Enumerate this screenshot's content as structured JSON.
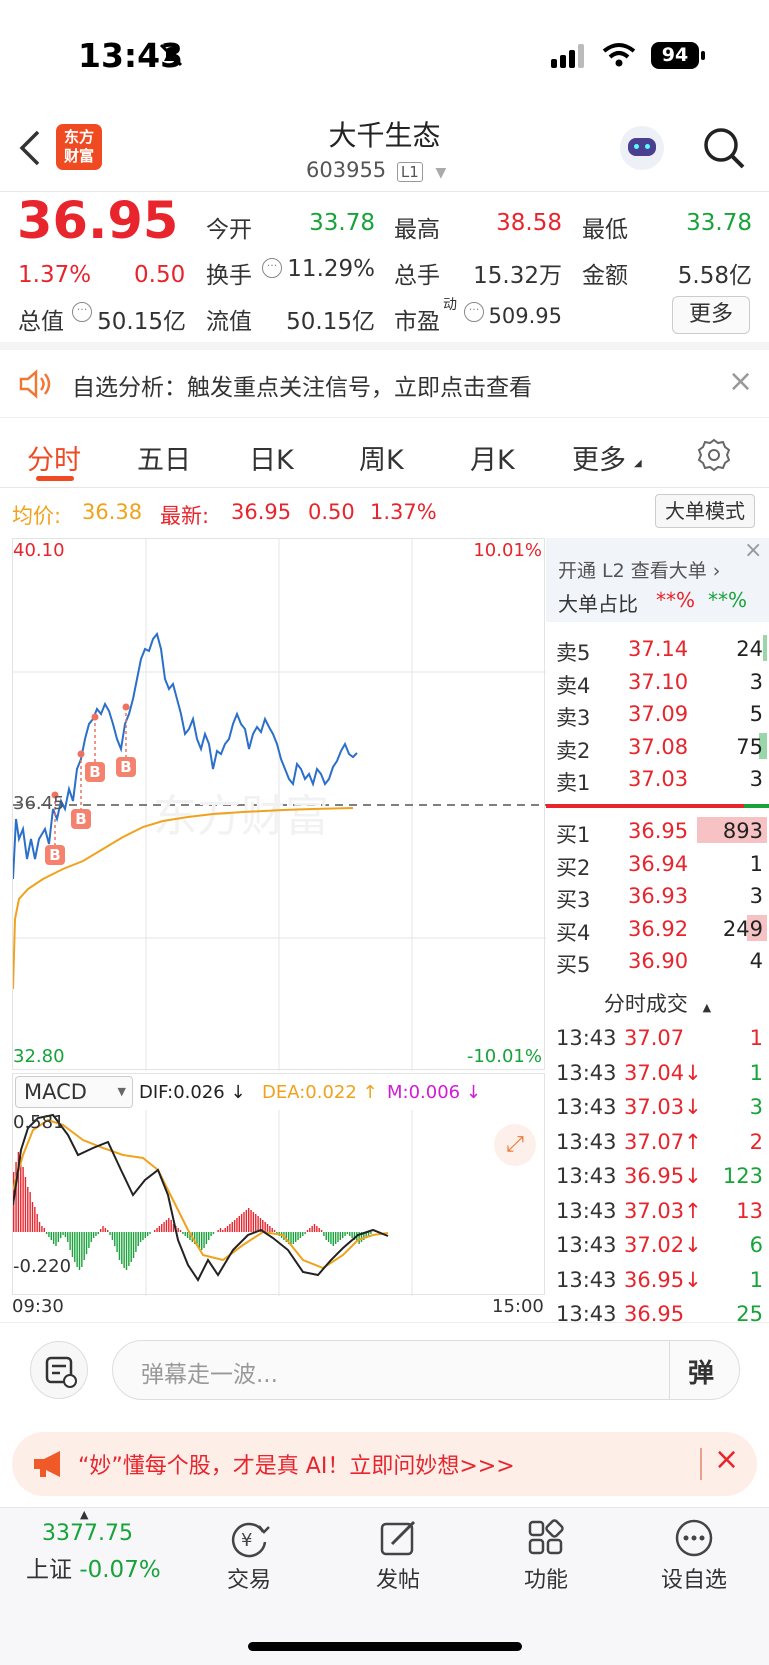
{
  "status": {
    "time": "13:43",
    "battery": "94"
  },
  "header": {
    "title": "大千生态",
    "code": "603955",
    "level": "L1",
    "logo_line1": "东方",
    "logo_line2": "财富"
  },
  "quote": {
    "price": "36.95",
    "change_pct": "1.37%",
    "change": "0.50",
    "open_label": "今开",
    "open": "33.78",
    "high_label": "最高",
    "high": "38.58",
    "low_label": "最低",
    "low": "33.78",
    "turnover_label": "换手",
    "turnover": "11.29%",
    "volume_label": "总手",
    "volume": "15.32万",
    "amount_label": "金额",
    "amount": "5.58亿",
    "mktcap_label": "总值",
    "mktcap": "50.15亿",
    "float_label": "流值",
    "float": "50.15亿",
    "pe_label": "市盈",
    "pe_sup": "动",
    "pe": "509.95",
    "more": "更多"
  },
  "notice": {
    "text": "自选分析：触发重点关注信号，立即点击查看"
  },
  "tabs": [
    "分时",
    "五日",
    "日K",
    "周K",
    "月K",
    "更多"
  ],
  "infoline": {
    "avg_label": "均价:",
    "avg": "36.38",
    "latest_label": "最新:",
    "latest": "36.95",
    "chg": "0.50",
    "pct": "1.37%",
    "mode": "大单模式"
  },
  "chart": {
    "y_top": "40.10",
    "y_bottom": "32.80",
    "pct_top": "10.01%",
    "pct_bottom": "-10.01%",
    "prev_close": "36.45",
    "watermark": "东方财富",
    "marker": "B"
  },
  "macd": {
    "indicator": "MACD",
    "dif": "DIF:0.026 ↓",
    "dea": "DEA:0.022 ↑",
    "m": "M:0.006 ↓",
    "max": "0.581",
    "min": "-0.220",
    "t_start": "09:30",
    "t_end": "15:00"
  },
  "side": {
    "l2": "开通 L2 查看大单 ›",
    "ratio_label": "大单占比",
    "r1": "**%",
    "r2": "**%",
    "asks": [
      {
        "l": "卖5",
        "p": "37.14",
        "v": "24"
      },
      {
        "l": "卖4",
        "p": "37.10",
        "v": "3"
      },
      {
        "l": "卖3",
        "p": "37.09",
        "v": "5"
      },
      {
        "l": "卖2",
        "p": "37.08",
        "v": "75"
      },
      {
        "l": "卖1",
        "p": "37.03",
        "v": "3"
      }
    ],
    "bids": [
      {
        "l": "买1",
        "p": "36.95",
        "v": "893"
      },
      {
        "l": "买2",
        "p": "36.94",
        "v": "1"
      },
      {
        "l": "买3",
        "p": "36.93",
        "v": "3"
      },
      {
        "l": "买4",
        "p": "36.92",
        "v": "249"
      },
      {
        "l": "买5",
        "p": "36.90",
        "v": "4"
      }
    ],
    "trades_title": "分时成交",
    "trades": [
      {
        "t": "13:43",
        "p": "37.07",
        "v": "1",
        "c": "red"
      },
      {
        "t": "13:43",
        "p": "37.04↓",
        "v": "1",
        "c": "green"
      },
      {
        "t": "13:43",
        "p": "37.03↓",
        "v": "3",
        "c": "green"
      },
      {
        "t": "13:43",
        "p": "37.07↑",
        "v": "2",
        "c": "red"
      },
      {
        "t": "13:43",
        "p": "36.95↓",
        "v": "123",
        "c": "green"
      },
      {
        "t": "13:43",
        "p": "37.03↑",
        "v": "13",
        "c": "red"
      },
      {
        "t": "13:43",
        "p": "37.02↓",
        "v": "6",
        "c": "green"
      },
      {
        "t": "13:43",
        "p": "36.95↓",
        "v": "1",
        "c": "green"
      },
      {
        "t": "13:43",
        "p": "36.95",
        "v": "25",
        "c": "green"
      }
    ]
  },
  "danmu": {
    "placeholder": "弹幕走一波...",
    "btn": "弹"
  },
  "ad": {
    "text": "“妙”懂每个股，才是真 AI！立即问妙想>>>"
  },
  "bottom": {
    "index_value": "3377.75",
    "index_name": "上证",
    "index_pct": "-0.07%",
    "items": [
      "交易",
      "发帖",
      "功能",
      "设自选"
    ]
  },
  "colors": {
    "up": "#e8242c",
    "down": "#18a33a",
    "line": "#2a6fc9",
    "avg": "#f0a21d"
  }
}
